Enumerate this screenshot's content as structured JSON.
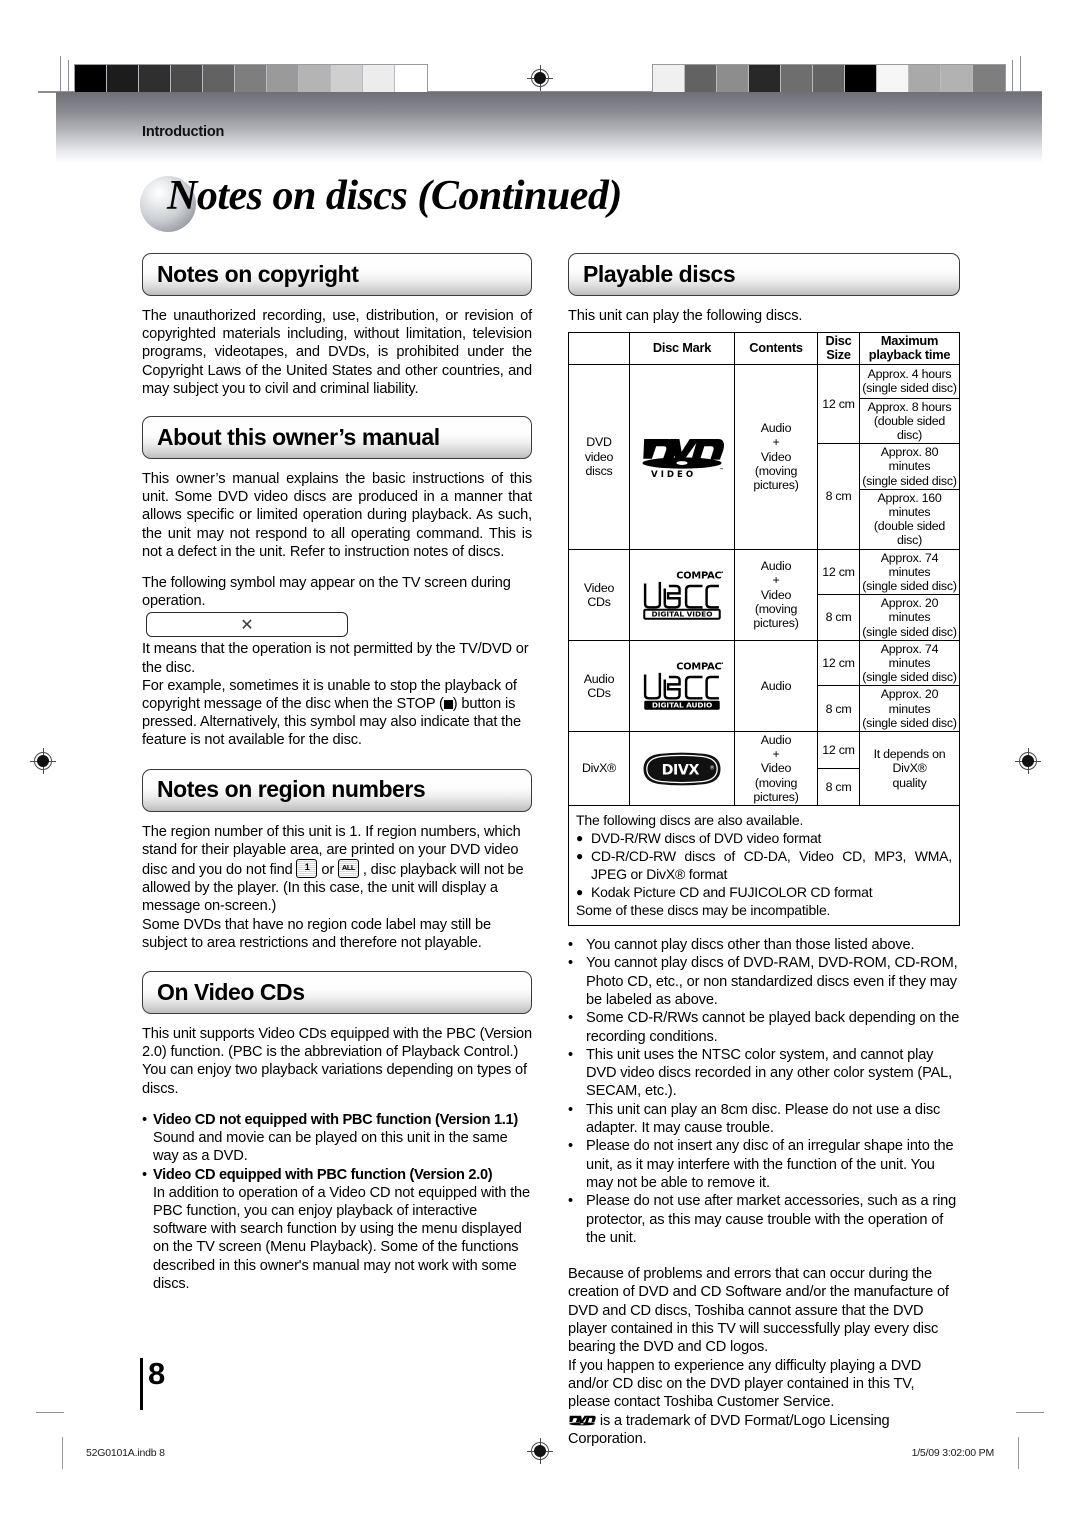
{
  "document": {
    "section_label": "Introduction",
    "page_title": "Notes on discs (Continued)",
    "page_number": "8",
    "footer_left": "52G0101A.indb   8",
    "footer_right": "1/5/09   3:02:00 PM"
  },
  "calibration": {
    "left_swatches": [
      "#000000",
      "#1c1c1c",
      "#2f2f2f",
      "#4b4b4b",
      "#626262",
      "#7e7e7e",
      "#9a9a9a",
      "#b4b4b4",
      "#cfcfcf",
      "#ececec",
      "#ffffff"
    ],
    "right_swatches": [
      "#f0f0f0",
      "#626262",
      "#8d8d8d",
      "#282828",
      "#6e6e6e",
      "#636363",
      "#000000",
      "#f6f6f6",
      "#a9a9a9",
      "#b2b2b2",
      "#7e7e7e"
    ]
  },
  "left_column": {
    "copyright": {
      "heading": "Notes on copyright",
      "paragraph": "The unauthorized recording, use, distribution, or revision of copyrighted materials including, without limitation, television programs, videotapes, and DVDs, is prohibited under the Copyright Laws of the United States and other countries, and may subject you to civil and criminal liability."
    },
    "manual": {
      "heading": "About this owner’s manual",
      "paragraph1": "This owner’s manual explains the basic instructions of this unit. Some DVD video discs are produced in a manner that allows specific or limited operation during playback. As such, the unit may not respond to all operating command. This is not a defect in the unit. Refer to instruction notes of discs.",
      "paragraph2": "The following symbol may appear on the TV screen during operation.",
      "symbol": "✕",
      "paragraph3_a": "It means that the operation is not permitted by the TV/DVD or the disc.",
      "paragraph3_b_pre": "For example, sometimes it is unable to stop the playback of copyright message of the disc when the STOP (",
      "paragraph3_b_post": ") button is pressed. Alternatively, this symbol may also indicate that the feature is not available for the disc."
    },
    "region": {
      "heading": "Notes on region numbers",
      "paragraph1_pre": "The region number of this unit is 1. If region numbers, which stand for their playable area, are printed on your DVD video disc and you do not find ",
      "icon1_label": "1",
      "paragraph1_mid": " or ",
      "icon2_label": "ALL",
      "paragraph1_post": " , disc playback will not be allowed by the player. (In this case, the unit will display a message on-screen.)",
      "paragraph2": "Some DVDs that have no region code label may still be subject to area restrictions and therefore not playable."
    },
    "videocds": {
      "heading": "On Video CDs",
      "paragraph1": "This unit supports Video CDs equipped with the PBC (Version 2.0) function. (PBC is the abbreviation of Playback Control.) You can enjoy two playback variations depending on types of discs.",
      "bullets": [
        {
          "dot": "•",
          "lead": "Video CD not equipped with PBC function (Version 1.1)",
          "text": "Sound and movie can be played on this unit in the same way as a DVD."
        },
        {
          "dot": "•",
          "lead": "Video CD equipped with PBC function (Version 2.0)",
          "text": "In addition to operation of a Video CD not equipped with the PBC function, you can enjoy playback of interactive software with search function by using the menu displayed on the TV screen (Menu Playback). Some of the functions described in this owner's manual may not work with some discs."
        }
      ]
    }
  },
  "right_column": {
    "playable": {
      "heading": "Playable discs",
      "intro": "This unit can play the following discs.",
      "table": {
        "headers": [
          "",
          "Disc Mark",
          "Contents",
          "Disc Size",
          "Maximum playback time"
        ],
        "header_cells": {
          "blank": "",
          "disc_mark": "Disc Mark",
          "contents": "Contents",
          "disc_size_l1": "Disc",
          "disc_size_l2": "Size",
          "max_time_l1": "Maximum",
          "max_time_l2": "playback time"
        },
        "rows": [
          {
            "category_l1": "DVD",
            "category_l2": "video",
            "category_l3": "discs",
            "mark": "dvd-video-logo",
            "contents_l1": "Audio",
            "contents_l2": "+",
            "contents_l3": "Video",
            "contents_l4": "(moving",
            "contents_l5": "pictures)",
            "sizes": [
              {
                "size": "12 cm",
                "times": [
                  {
                    "l1": "Approx. 4 hours",
                    "l2": "(single sided disc)"
                  },
                  {
                    "l1": "Approx. 8 hours",
                    "l2": "(double sided disc)"
                  }
                ]
              },
              {
                "size": "8 cm",
                "times": [
                  {
                    "l1": "Approx. 80 minutes",
                    "l2": "(single sided disc)"
                  },
                  {
                    "l1": "Approx. 160 minutes",
                    "l2": "(double sided disc)"
                  }
                ]
              }
            ]
          },
          {
            "category_l1": "Video",
            "category_l2": "CDs",
            "mark": "compact-disc-digital-video-logo",
            "contents_l1": "Audio",
            "contents_l2": "+",
            "contents_l3": "Video",
            "contents_l4": "(moving",
            "contents_l5": "pictures)",
            "sizes": [
              {
                "size": "12 cm",
                "times": [
                  {
                    "l1": "Approx. 74 minutes",
                    "l2": "(single sided disc)"
                  }
                ]
              },
              {
                "size": "8 cm",
                "times": [
                  {
                    "l1": "Approx. 20 minutes",
                    "l2": "(single sided disc)"
                  }
                ]
              }
            ]
          },
          {
            "category_l1": "Audio",
            "category_l2": "CDs",
            "mark": "compact-disc-digital-audio-logo",
            "contents_l1": "Audio",
            "sizes": [
              {
                "size": "12 cm",
                "times": [
                  {
                    "l1": "Approx. 74 minutes",
                    "l2": "(single sided disc)"
                  }
                ]
              },
              {
                "size": "8 cm",
                "times": [
                  {
                    "l1": "Approx. 20 minutes",
                    "l2": "(single sided disc)"
                  }
                ]
              }
            ]
          },
          {
            "category_l1": "DivX®",
            "mark": "divx-logo",
            "contents_l1": "Audio",
            "contents_l2": "+",
            "contents_l3": "Video",
            "contents_l4": "(moving",
            "contents_l5": "pictures)",
            "sizes": [
              {
                "size": "12 cm",
                "times": [
                  {
                    "l1": "It depends on DivX®",
                    "l2": "quality"
                  }
                ]
              },
              {
                "size": "8 cm",
                "times": []
              }
            ]
          }
        ]
      },
      "also_available": {
        "intro": "The following discs are also available.",
        "items": [
          {
            "dot": "●",
            "text": "DVD-R/RW discs of DVD video format"
          },
          {
            "dot": "●",
            "text": "CD-R/CD-RW discs of CD-DA, Video CD, MP3, WMA, JPEG or DivX® format"
          },
          {
            "dot": "●",
            "text": "Kodak Picture CD and FUJICOLOR CD format"
          }
        ],
        "outro": "Some of these discs may be incompatible."
      },
      "notes": [
        {
          "dot": "•",
          "text": "You cannot play discs other than those listed above."
        },
        {
          "dot": "•",
          "text": "You cannot play discs of DVD-RAM, DVD-ROM, CD-ROM, Photo CD, etc., or non standardized discs even if they may be labeled as above."
        },
        {
          "dot": "•",
          "text": "Some CD-R/RWs cannot be played back depending on the recording conditions."
        },
        {
          "dot": "•",
          "text": "This unit uses the NTSC color system, and cannot play DVD video discs recorded in any other color system (PAL, SECAM, etc.)."
        },
        {
          "dot": "•",
          "text": "This unit can play an 8cm disc. Please do not use a disc adapter. It may cause trouble."
        },
        {
          "dot": "•",
          "text": "Please do not insert any disc of an irregular shape into the unit, as it may interfere with the function of the unit. You may not be able to remove it."
        },
        {
          "dot": "•",
          "text": "Please do not use after market accessories, such as a ring protector, as this may cause trouble with the operation of the unit."
        }
      ],
      "closing_paragraph1": "Because of problems and errors that can occur during the creation of DVD and CD Software and/or the manufacture of DVD and CD discs, Toshiba cannot assure that the DVD player contained in this TV will successfully play every disc bearing the DVD and CD logos.",
      "closing_paragraph2": "If you happen to experience any difficulty playing a DVD and/or CD disc on the DVD player contained in this TV, please contact Toshiba Customer Service.",
      "trademark_text": " is a trademark of DVD Format/Logo Licensing Corporation."
    }
  }
}
